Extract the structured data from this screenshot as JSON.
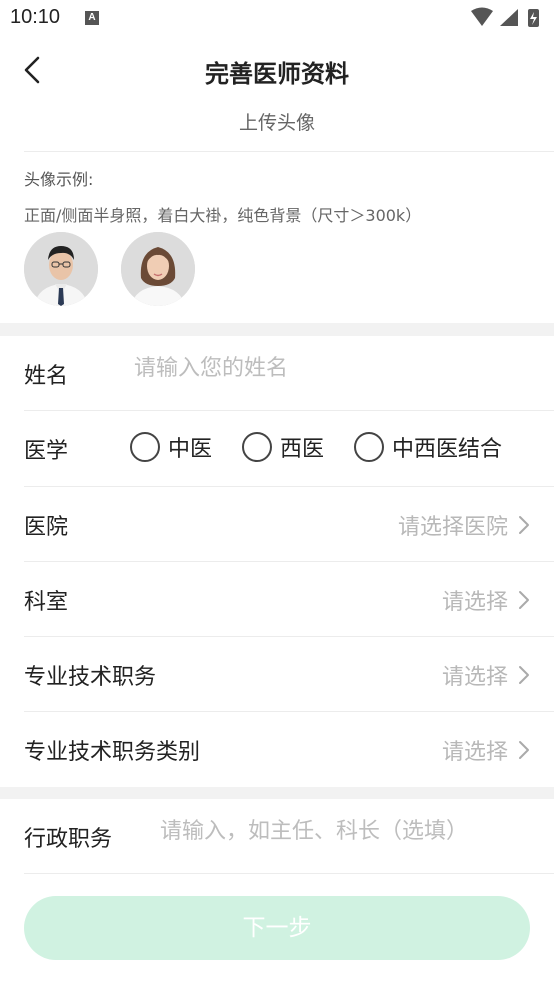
{
  "status_bar": {
    "time": "10:10",
    "notification_badge": "A"
  },
  "header": {
    "title": "完善医师资料"
  },
  "avatar_section": {
    "upload_label": "上传头像",
    "example_title": "头像示例:",
    "example_desc": "正面/侧面半身照，着白大褂，纯色背景（尺寸＞300k）"
  },
  "form": {
    "name": {
      "label": "姓名",
      "placeholder": "请输入您的姓名"
    },
    "medicine": {
      "label": "医学",
      "options": [
        "中医",
        "西医",
        "中西医结合"
      ]
    },
    "hospital": {
      "label": "医院",
      "placeholder": "请选择医院"
    },
    "department": {
      "label": "科室",
      "placeholder": "请选择"
    },
    "professional_title": {
      "label": "专业技术职务",
      "placeholder": "请选择"
    },
    "professional_category": {
      "label": "专业技术职务类别",
      "placeholder": "请选择"
    },
    "admin_title": {
      "label": "行政职务",
      "placeholder": "请输入，如主任、科长（选填）"
    }
  },
  "footer": {
    "next_label": "下一步"
  },
  "colors": {
    "accent_disabled": "#d0f2e1",
    "placeholder": "#bdbdbd",
    "band": "#f2f2f2"
  }
}
